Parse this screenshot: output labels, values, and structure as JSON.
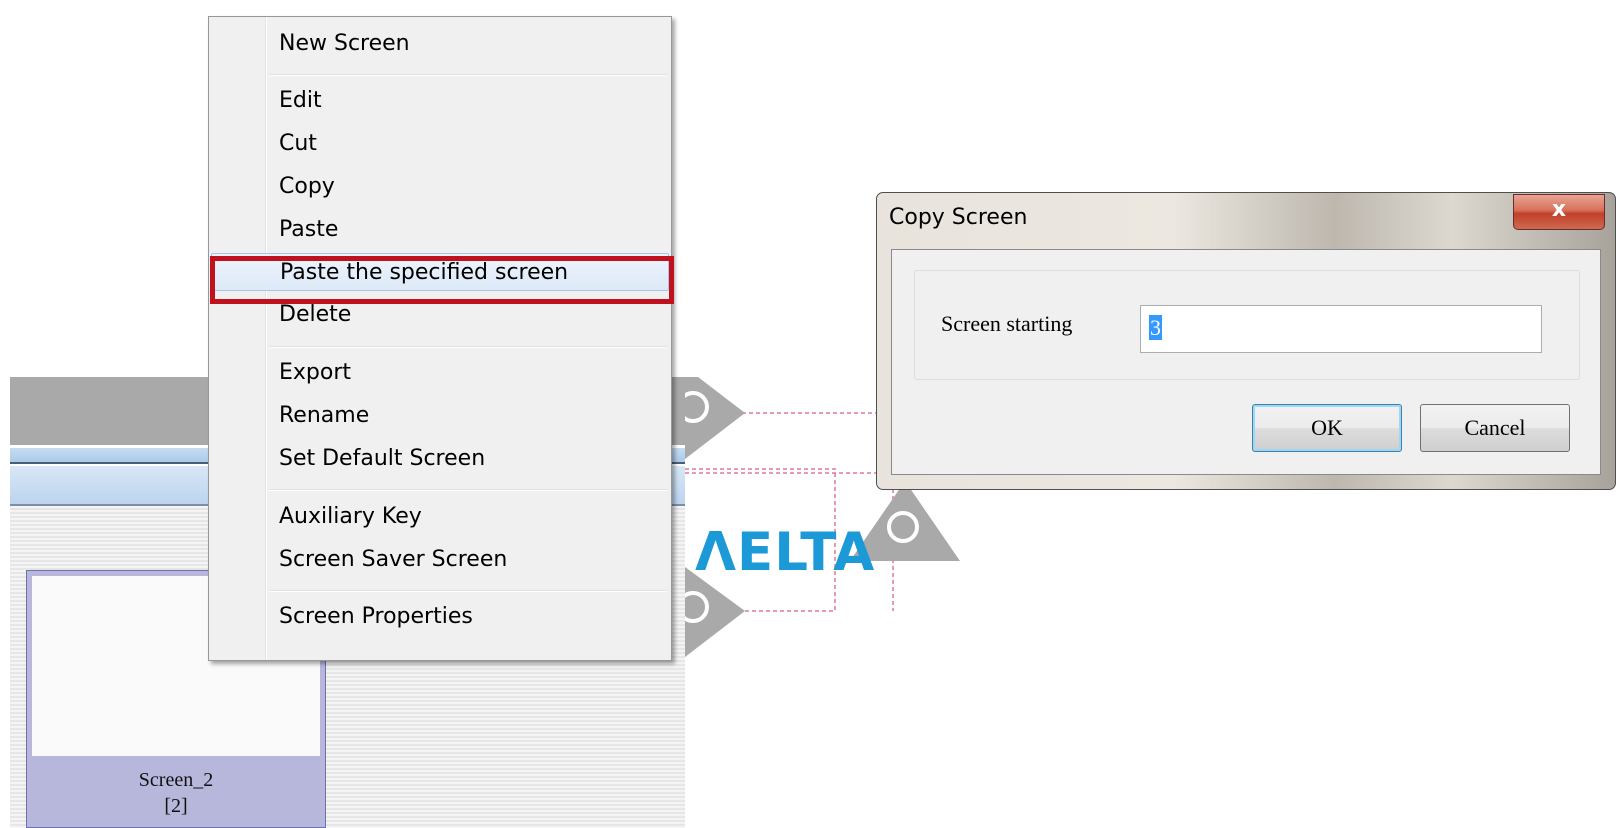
{
  "context_menu": {
    "items": [
      {
        "label": "New Screen"
      },
      {
        "label": "Edit"
      },
      {
        "label": "Cut"
      },
      {
        "label": "Copy"
      },
      {
        "label": "Paste"
      },
      {
        "label": "Paste the specified screen",
        "highlighted": true
      },
      {
        "label": "Delete"
      },
      {
        "label": "Export"
      },
      {
        "label": "Rename"
      },
      {
        "label": "Set Default Screen"
      },
      {
        "label": "Auxiliary Key"
      },
      {
        "label": "Screen Saver Screen"
      },
      {
        "label": "Screen Properties"
      }
    ]
  },
  "screen_thumbnail": {
    "name": "Screen_2",
    "id": "[2]"
  },
  "canvas": {
    "logo_text": "ΛELTA",
    "logo_color": "#1b9ad7"
  },
  "dialog": {
    "title": "Copy Screen",
    "close_label": "x",
    "field_label": "Screen starting",
    "field_value": "3",
    "ok_label": "OK",
    "cancel_label": "Cancel"
  },
  "colors": {
    "highlight_border": "#c0121c",
    "menu_background": "#f0f0f0",
    "thumbnail_background": "#b7b7dc"
  }
}
